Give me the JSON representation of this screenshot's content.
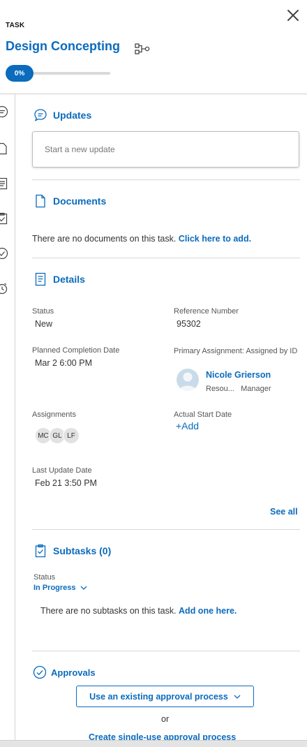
{
  "header": {
    "task_label": "TASK",
    "title": "Design Concepting",
    "progress_label": "0%",
    "progress_value": 0
  },
  "updates": {
    "heading": "Updates",
    "placeholder": "Start a new update"
  },
  "documents": {
    "heading": "Documents",
    "empty_text": "There are no documents on this task.",
    "add_link": "Click here to add."
  },
  "details": {
    "heading": "Details",
    "status_label": "Status",
    "status_value": "New",
    "reference_label": "Reference Number",
    "reference_value": "95302",
    "planned_label": "Planned Completion Date",
    "planned_value": "Mar 2 6:00 PM",
    "primary_label": "Primary Assignment: Assigned by ID",
    "assignee_name": "Nicole Grierson",
    "assignee_role_1": "Resou...",
    "assignee_role_2": "Manager",
    "assignments_label": "Assignments",
    "assignment_chips": [
      "MC",
      "GL",
      "LF"
    ],
    "actual_start_label": "Actual Start Date",
    "actual_start_add": "+Add",
    "last_update_label": "Last Update Date",
    "last_update_value": "Feb 21 3:50 PM",
    "see_all": "See all"
  },
  "subtasks": {
    "heading": "Subtasks (0)",
    "status_label": "Status",
    "status_value": "In Progress",
    "empty_text": "There are no subtasks on this task.",
    "add_link": "Add one here."
  },
  "approvals": {
    "heading": "Approvals",
    "existing_button": "Use an existing approval process",
    "or_text": "or",
    "create_link": "Create single-use approval process"
  },
  "colors": {
    "accent": "#0b6bbd"
  }
}
